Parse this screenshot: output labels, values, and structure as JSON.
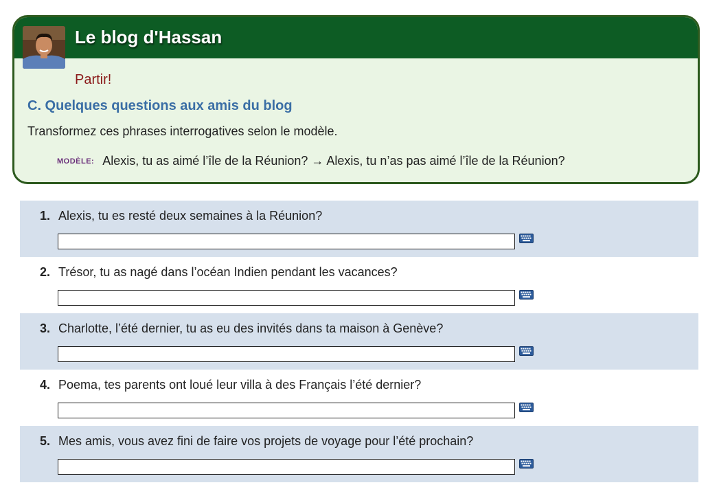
{
  "blog": {
    "title": "Le blog d'Hassan",
    "subtitle": "Partir!",
    "section_heading": "C. Quelques questions aux amis du blog",
    "instructions": "Transformez ces phrases interrogatives selon le modèle.",
    "model_label": "MODÈLE:",
    "model_text": "Alexis, tu as aimé l’île de la Réunion? → Alexis, tu n’as pas aimé l’île de la Réunion?"
  },
  "questions": [
    {
      "number": "1.",
      "text": "Alexis, tu es resté deux semaines à la Réunion?",
      "answer": ""
    },
    {
      "number": "2.",
      "text": "Trésor, tu as nagé dans l’océan Indien pendant les vacances?",
      "answer": ""
    },
    {
      "number": "3.",
      "text": "Charlotte, l’été dernier, tu as eu des invités dans ta maison à Genève?",
      "answer": ""
    },
    {
      "number": "4.",
      "text": "Poema, tes parents ont loué leur villa à des Français l’été dernier?",
      "answer": ""
    },
    {
      "number": "5.",
      "text": "Mes amis, vous avez fini de faire vos projets de voyage pour l’été prochain?",
      "answer": ""
    }
  ],
  "colors": {
    "header_green": "#0d5c24",
    "card_bg": "#eaf5e4",
    "heading_blue": "#3a6ea5",
    "subtitle_red": "#8b1a1a",
    "row_shade": "#d6e0ec"
  },
  "icons": {
    "avatar": "avatar",
    "keyboard": "keyboard-icon"
  }
}
